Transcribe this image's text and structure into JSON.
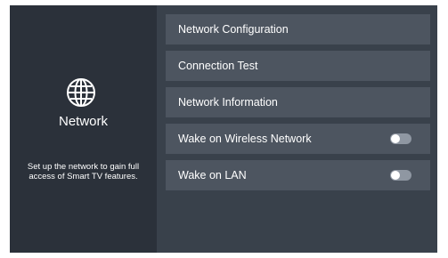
{
  "panel": {
    "icon": "globe-icon",
    "title": "Network",
    "description_line1": "Set up the network to gain full",
    "description_line2": "access of Smart TV features."
  },
  "menu": {
    "items": [
      {
        "label": "Network Configuration"
      },
      {
        "label": "Connection Test"
      },
      {
        "label": "Network Information"
      },
      {
        "label": "Wake on Wireless Network",
        "toggle": "off"
      },
      {
        "label": "Wake on LAN",
        "toggle": "off"
      }
    ]
  },
  "colors": {
    "left_panel_bg": "#2b313a",
    "right_panel_bg": "#39414b",
    "menu_item_bg": "#4d5560",
    "toggle_off": "#8f97a2",
    "text": "#ffffff"
  }
}
